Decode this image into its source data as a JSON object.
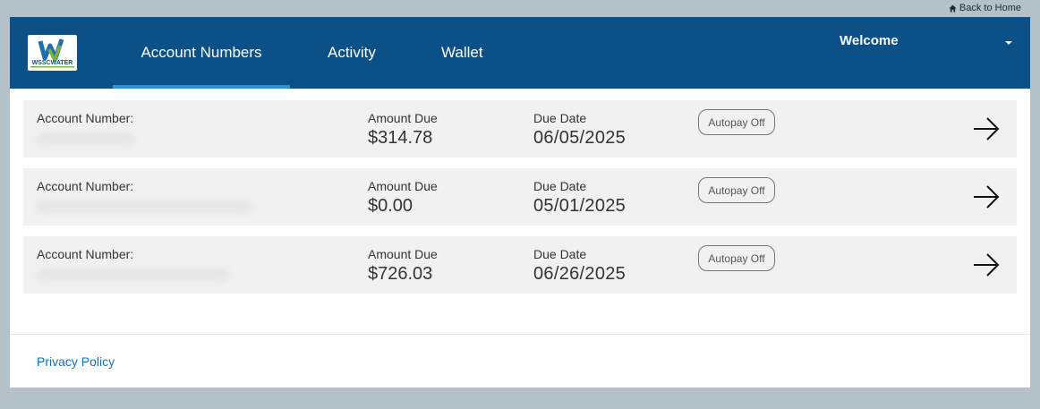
{
  "top": {
    "back_home": "Back to Home"
  },
  "header": {
    "logo_text": "WSSCWATER",
    "nav": [
      {
        "label": "Account Numbers",
        "active": true
      },
      {
        "label": "Activity",
        "active": false
      },
      {
        "label": "Wallet",
        "active": false
      }
    ],
    "welcome": "Welcome"
  },
  "accounts": [
    {
      "account_label": "Account Number:",
      "amount_label": "Amount Due",
      "amount": "$314.78",
      "due_label": "Due Date",
      "due_date": "06/05/2025",
      "autopay": "Autopay Off"
    },
    {
      "account_label": "Account Number:",
      "amount_label": "Amount Due",
      "amount": "$0.00",
      "due_label": "Due Date",
      "due_date": "05/01/2025",
      "autopay": "Autopay Off"
    },
    {
      "account_label": "Account Number:",
      "amount_label": "Amount Due",
      "amount": "$726.03",
      "due_label": "Due Date",
      "due_date": "06/26/2025",
      "autopay": "Autopay Off"
    }
  ],
  "footer": {
    "privacy": "Privacy Policy"
  },
  "colors": {
    "header_bg": "#0b5188",
    "active_tab": "#2f8fd6",
    "link": "#1a6fb6",
    "page_bg": "#b4c1c9"
  }
}
